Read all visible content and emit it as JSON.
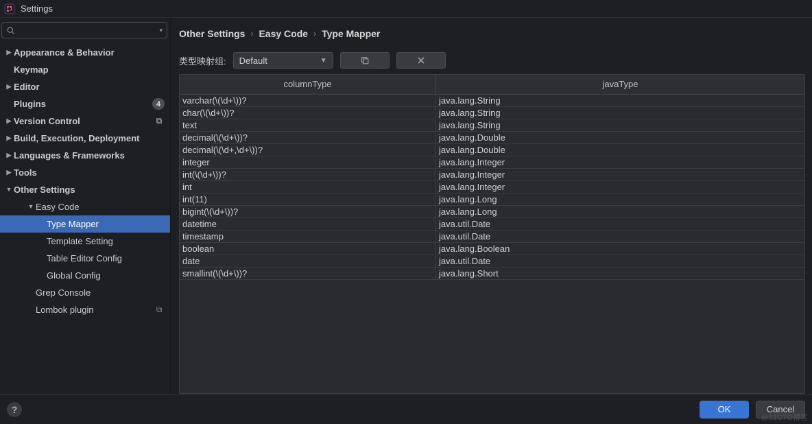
{
  "window": {
    "title": "Settings"
  },
  "search": {
    "placeholder": ""
  },
  "sidebar": {
    "items": [
      {
        "label": "Appearance & Behavior",
        "caret": "closed",
        "top": true
      },
      {
        "label": "Keymap",
        "caret": "none",
        "top": true
      },
      {
        "label": "Editor",
        "caret": "closed",
        "top": true
      },
      {
        "label": "Plugins",
        "caret": "none",
        "top": true,
        "badge": "4"
      },
      {
        "label": "Version Control",
        "caret": "closed",
        "top": true,
        "glyph": "⧉"
      },
      {
        "label": "Build, Execution, Deployment",
        "caret": "closed",
        "top": true
      },
      {
        "label": "Languages & Frameworks",
        "caret": "closed",
        "top": true
      },
      {
        "label": "Tools",
        "caret": "closed",
        "top": true
      },
      {
        "label": "Other Settings",
        "caret": "open",
        "top": true
      },
      {
        "label": "Easy Code",
        "caret": "open",
        "depth": 2
      },
      {
        "label": "Type Mapper",
        "caret": "none",
        "depth": 3,
        "selected": true
      },
      {
        "label": "Template Setting",
        "caret": "none",
        "depth": 3
      },
      {
        "label": "Table Editor Config",
        "caret": "none",
        "depth": 3
      },
      {
        "label": "Global Config",
        "caret": "none",
        "depth": 3
      },
      {
        "label": "Grep Console",
        "caret": "none",
        "depth": 2
      },
      {
        "label": "Lombok plugin",
        "caret": "none",
        "depth": 2,
        "glyph": "⧉"
      }
    ]
  },
  "breadcrumb": [
    "Other Settings",
    "Easy Code",
    "Type Mapper"
  ],
  "toolbar": {
    "group_label": "类型映射组:",
    "dropdown_value": "Default"
  },
  "table": {
    "headers": [
      "columnType",
      "javaType"
    ],
    "rows": [
      {
        "columnType": "varchar(\\(\\d+\\))?",
        "javaType": "java.lang.String"
      },
      {
        "columnType": "char(\\(\\d+\\))?",
        "javaType": "java.lang.String"
      },
      {
        "columnType": "text",
        "javaType": "java.lang.String"
      },
      {
        "columnType": "decimal(\\(\\d+\\))?",
        "javaType": "java.lang.Double"
      },
      {
        "columnType": "decimal(\\(\\d+,\\d+\\))?",
        "javaType": "java.lang.Double"
      },
      {
        "columnType": "integer",
        "javaType": "java.lang.Integer"
      },
      {
        "columnType": "int(\\(\\d+\\))?",
        "javaType": "java.lang.Integer"
      },
      {
        "columnType": "int",
        "javaType": "java.lang.Integer"
      },
      {
        "columnType": "int(11)",
        "javaType": "java.lang.Long"
      },
      {
        "columnType": "bigint(\\(\\d+\\))?",
        "javaType": "java.lang.Long"
      },
      {
        "columnType": "datetime",
        "javaType": "java.util.Date"
      },
      {
        "columnType": "timestamp",
        "javaType": "java.util.Date"
      },
      {
        "columnType": "boolean",
        "javaType": "java.lang.Boolean"
      },
      {
        "columnType": "date",
        "javaType": "java.util.Date"
      },
      {
        "columnType": "smallint(\\(\\d+\\))?",
        "javaType": "java.lang.Short"
      }
    ]
  },
  "footer": {
    "ok": "OK",
    "cancel": "Cancel",
    "help": "?"
  },
  "watermark": "@51CTO博客"
}
